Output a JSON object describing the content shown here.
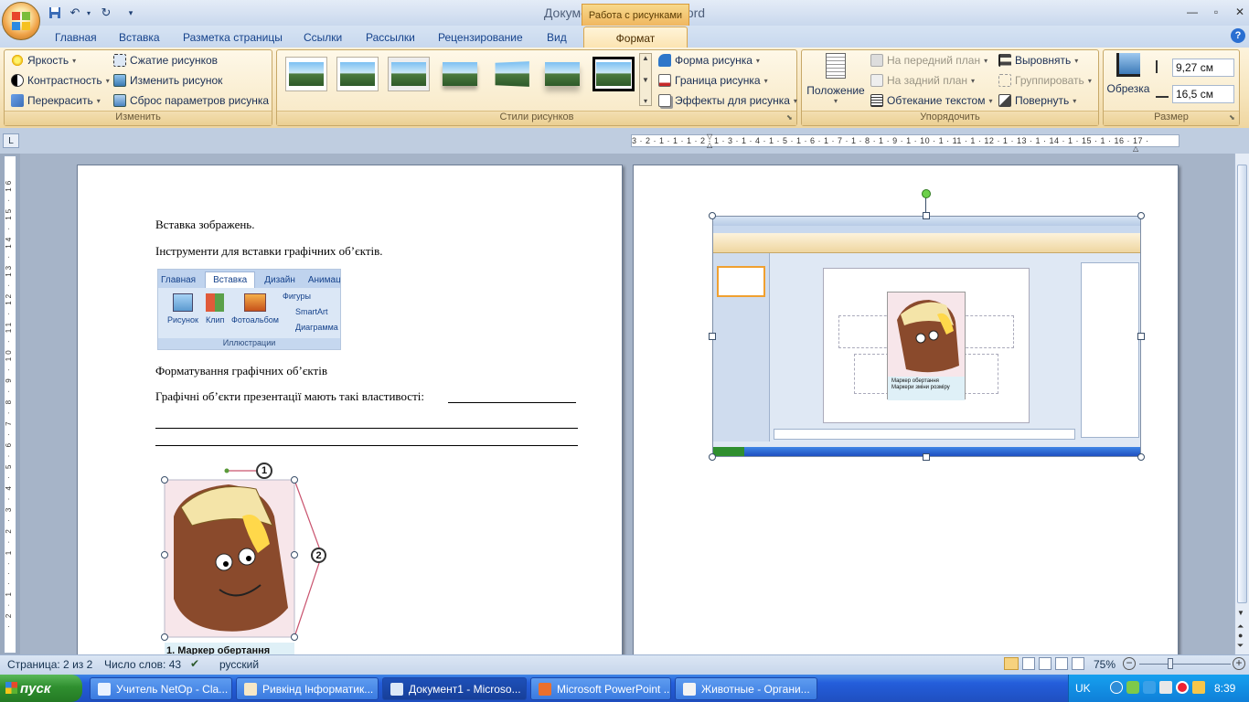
{
  "titlebar": {
    "title": "Документ1 - Microsoft Word",
    "contextual_tab": "Работа с рисунками"
  },
  "tabs": [
    "Главная",
    "Вставка",
    "Разметка страницы",
    "Ссылки",
    "Рассылки",
    "Рецензирование",
    "Вид",
    "Формат"
  ],
  "ribbon": {
    "adjust": {
      "brightness": "Яркость",
      "contrast": "Контрастность",
      "recolor": "Перекрасить",
      "compress": "Сжатие рисунков",
      "change": "Изменить рисунок",
      "reset": "Сброс параметров рисунка",
      "label": "Изменить"
    },
    "styles": {
      "shape": "Форма рисунка",
      "border": "Граница рисунка",
      "effects": "Эффекты для рисунка",
      "label": "Стили рисунков"
    },
    "arrange": {
      "position": "Положение",
      "front": "На передний план",
      "back": "На задний план",
      "wrap": "Обтекание текстом",
      "align": "Выровнять",
      "group": "Группировать",
      "rotate": "Повернуть",
      "label": "Упорядочить"
    },
    "size": {
      "crop": "Обрезка",
      "height": "9,27 см",
      "width": "16,5 см",
      "label": "Размер"
    }
  },
  "ruler_text": "3 · 2 · 1 · 1 · 1 · 2 · 1 · 3 · 1 · 4 · 1 · 5 · 1 · 6 · 1 · 7 · 1 · 8 · 1 · 9 · 1 · 10 · 1 · 11 · 1 · 12 · 1 · 13 · 1 · 14 · 1 · 15 · 1 · 16 · 17 ·",
  "page1": {
    "line1": "Вставка зображень.",
    "line2": "Інструменти для вставки графічних об’єктів.",
    "snippet_tabs": [
      "Главная",
      "Вставка",
      "Дизайн",
      "Анимаци"
    ],
    "snippet_buttons": [
      "Рисунок",
      "Клип",
      "Фотоальбом"
    ],
    "snippet_small": [
      "Фигуры",
      "SmartArt",
      "Диаграмма"
    ],
    "snippet_group": "Иллюстрации",
    "line3": "Форматування графічних об’єктів",
    "line4": "Графічні об’єкти презентації мають такі властивості:",
    "marker1": "1",
    "marker2": "2",
    "caption": "1.  Маркер обертання"
  },
  "page2": {
    "marker1": "Маркер обертання",
    "marker2": "Маркери зміни розміру"
  },
  "statusbar": {
    "page": "Страница: 2 из 2",
    "words": "Число слов: 43",
    "language": "русский",
    "zoom": "75%"
  },
  "taskbar": {
    "start": "пуск",
    "tasks": [
      "Учитель NetOp - Cla...",
      "Ривкінд Інформатик...",
      "Документ1 - Microso...",
      "Microsoft PowerPoint ...",
      "Животные - Органи..."
    ],
    "lang": "UK",
    "time": "8:39"
  }
}
